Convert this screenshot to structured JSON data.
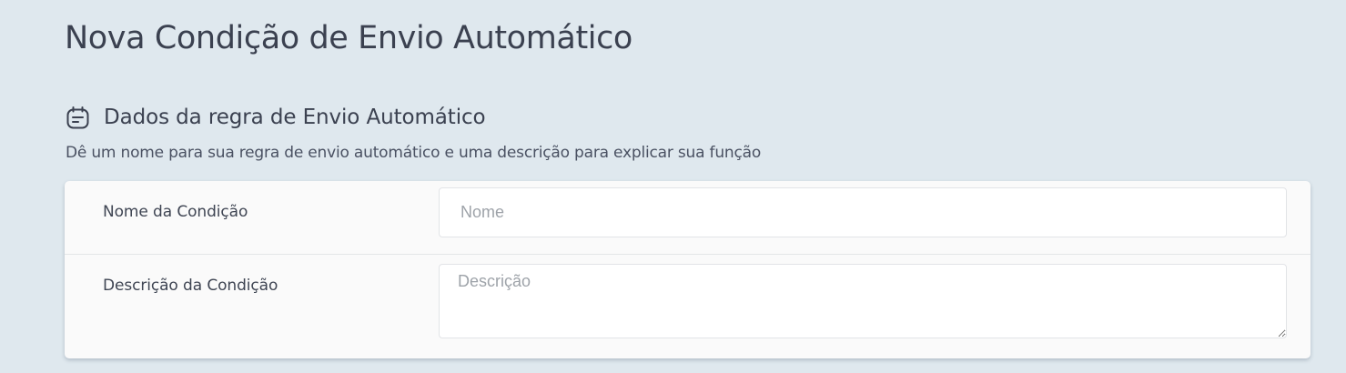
{
  "page": {
    "title": "Nova Condição de Envio Automático"
  },
  "section": {
    "icon": "calendar-note-icon",
    "title": "Dados da regra de Envio Automático",
    "description": "Dê um nome para sua regra de envio automático e uma descrição para explicar sua função"
  },
  "form": {
    "name_field": {
      "label": "Nome da Condição",
      "value": "",
      "placeholder": "Nome"
    },
    "description_field": {
      "label": "Descrição da Condição",
      "value": "",
      "placeholder": "Descrição"
    }
  },
  "colors": {
    "background": "#dfe8ee",
    "card": "#fafafa",
    "text_primary": "#3b4150",
    "placeholder": "#9ea3a9"
  }
}
